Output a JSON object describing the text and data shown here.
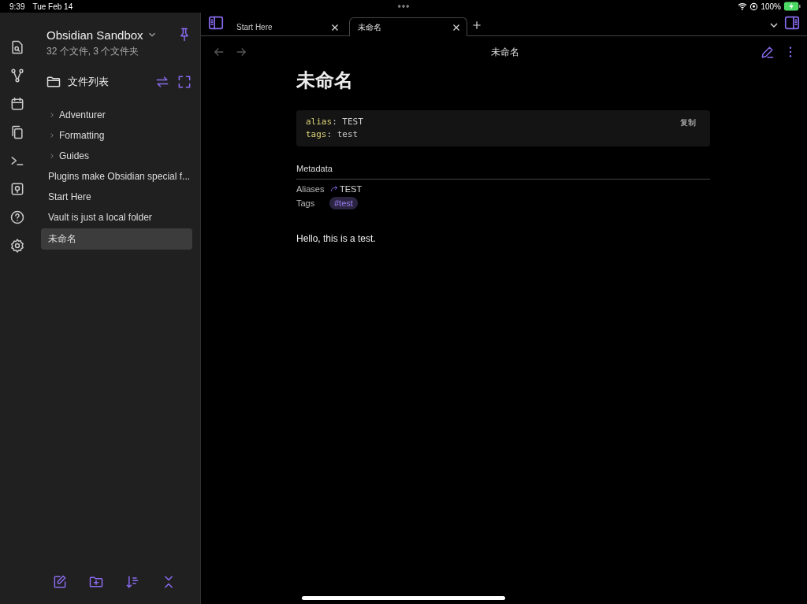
{
  "status_bar": {
    "time": "9:39",
    "date": "Tue Feb 14",
    "battery": "100%"
  },
  "sidebar": {
    "vault_name": "Obsidian Sandbox",
    "vault_info": "32 个文件, 3 个文件夹",
    "panel_title": "文件列表",
    "items": [
      {
        "label": "Adventurer",
        "kind": "folder",
        "selected": false
      },
      {
        "label": "Formatting",
        "kind": "folder",
        "selected": false
      },
      {
        "label": "Guides",
        "kind": "folder",
        "selected": false
      },
      {
        "label": "Plugins make Obsidian special f...",
        "kind": "file",
        "selected": false
      },
      {
        "label": "Start Here",
        "kind": "file",
        "selected": false
      },
      {
        "label": "Vault is just a local folder",
        "kind": "file",
        "selected": false
      },
      {
        "label": "未命名",
        "kind": "file",
        "selected": true
      }
    ]
  },
  "tabs": [
    {
      "label": "Start Here",
      "selected": false
    },
    {
      "label": "未命名",
      "selected": true
    }
  ],
  "view_title": "未命名",
  "note": {
    "title": "未命名",
    "copy_label": "复制",
    "frontmatter": [
      {
        "key": "alias",
        "separator": ":",
        "value": "TEST"
      },
      {
        "key": "tags",
        "separator": ":",
        "value": "test"
      }
    ],
    "metadata_heading": "Metadata",
    "properties": [
      {
        "label": "Aliases",
        "kind": "alias",
        "value": "TEST"
      },
      {
        "label": "Tags",
        "kind": "tag",
        "value": "#test"
      }
    ],
    "body": "Hello, this is a test."
  }
}
